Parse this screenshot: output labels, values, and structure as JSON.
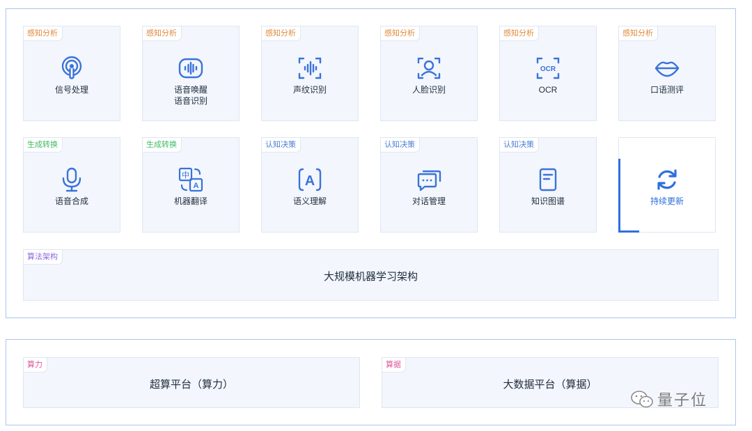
{
  "colors": {
    "accent_blue": "#2f6fde",
    "icon_blue": "#3a73d9",
    "tag_orange": "#e08a3c",
    "tag_green": "#3dbb62",
    "tag_blue": "#4a7fd8",
    "tag_purple": "#8a6be0",
    "tag_pink": "#e0569b",
    "border": "#a9c4ec",
    "card_bg": "#f3f6fc"
  },
  "capabilities": [
    {
      "tag": "感知分析",
      "icon": "signal-icon",
      "label": "信号处理",
      "label2": ""
    },
    {
      "tag": "感知分析",
      "icon": "voice-wave-icon",
      "label": "语音唤醒",
      "label2": "语音识别"
    },
    {
      "tag": "感知分析",
      "icon": "voiceprint-icon",
      "label": "声纹识别",
      "label2": ""
    },
    {
      "tag": "感知分析",
      "icon": "face-scan-icon",
      "label": "人脸识别",
      "label2": ""
    },
    {
      "tag": "感知分析",
      "icon": "ocr-icon",
      "label": "OCR",
      "icon_text": "OCR",
      "label2": ""
    },
    {
      "tag": "感知分析",
      "icon": "lips-icon",
      "label": "口语测评",
      "label2": ""
    },
    {
      "tag": "生成转换",
      "icon": "microphone-icon",
      "label": "语音合成",
      "label2": ""
    },
    {
      "tag": "生成转换",
      "icon": "translate-icon",
      "label": "机器翻译",
      "icon_text_a": "中",
      "icon_text_b": "A",
      "label2": ""
    },
    {
      "tag": "认知决策",
      "icon": "semantic-icon",
      "label": "语义理解",
      "icon_text": "A",
      "label2": ""
    },
    {
      "tag": "认知决策",
      "icon": "chat-icon",
      "label": "对话管理",
      "label2": ""
    },
    {
      "tag": "认知决策",
      "icon": "document-icon",
      "label": "知识图谱",
      "label2": ""
    },
    {
      "tag": "",
      "icon": "refresh-icon",
      "label": "持续更新",
      "label2": ""
    }
  ],
  "architecture": {
    "tag": "算法架构",
    "title": "大规模机器学习架构"
  },
  "platforms": [
    {
      "tag": "算力",
      "title": "超算平台（算力）"
    },
    {
      "tag": "算据",
      "title": "大数据平台（算据）"
    }
  ],
  "watermark": {
    "icon": "wechat-icon",
    "text": "量子位"
  }
}
